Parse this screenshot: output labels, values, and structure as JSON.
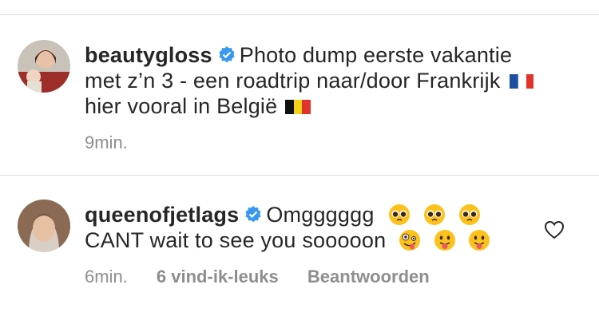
{
  "comments": [
    {
      "username": "beautygloss",
      "line1": "Photo dump eerste vakantie",
      "line2": "met z’n 3 - een roadtrip naar/door Frankrijk",
      "line3": "hier vooral in België",
      "time": "9min."
    },
    {
      "username": "queenofjetlags",
      "line1": "Omgggggg",
      "line2": "CANT wait to see you sooooon",
      "time": "6min.",
      "likes": "6 vind-ik-leuks",
      "reply": "Beantwoorden"
    }
  ],
  "icons": {
    "verified": "verified-badge-icon",
    "france": "france-flag-icon",
    "belgium": "belgium-flag-icon",
    "pleading": "pleading-face-icon",
    "zany": "zany-face-icon",
    "tongue": "tongue-face-icon",
    "heart": "heart-outline-icon"
  },
  "colors": {
    "verified": "#3897f0",
    "meta": "#8e8e8e",
    "divider": "#dbdbdb"
  }
}
